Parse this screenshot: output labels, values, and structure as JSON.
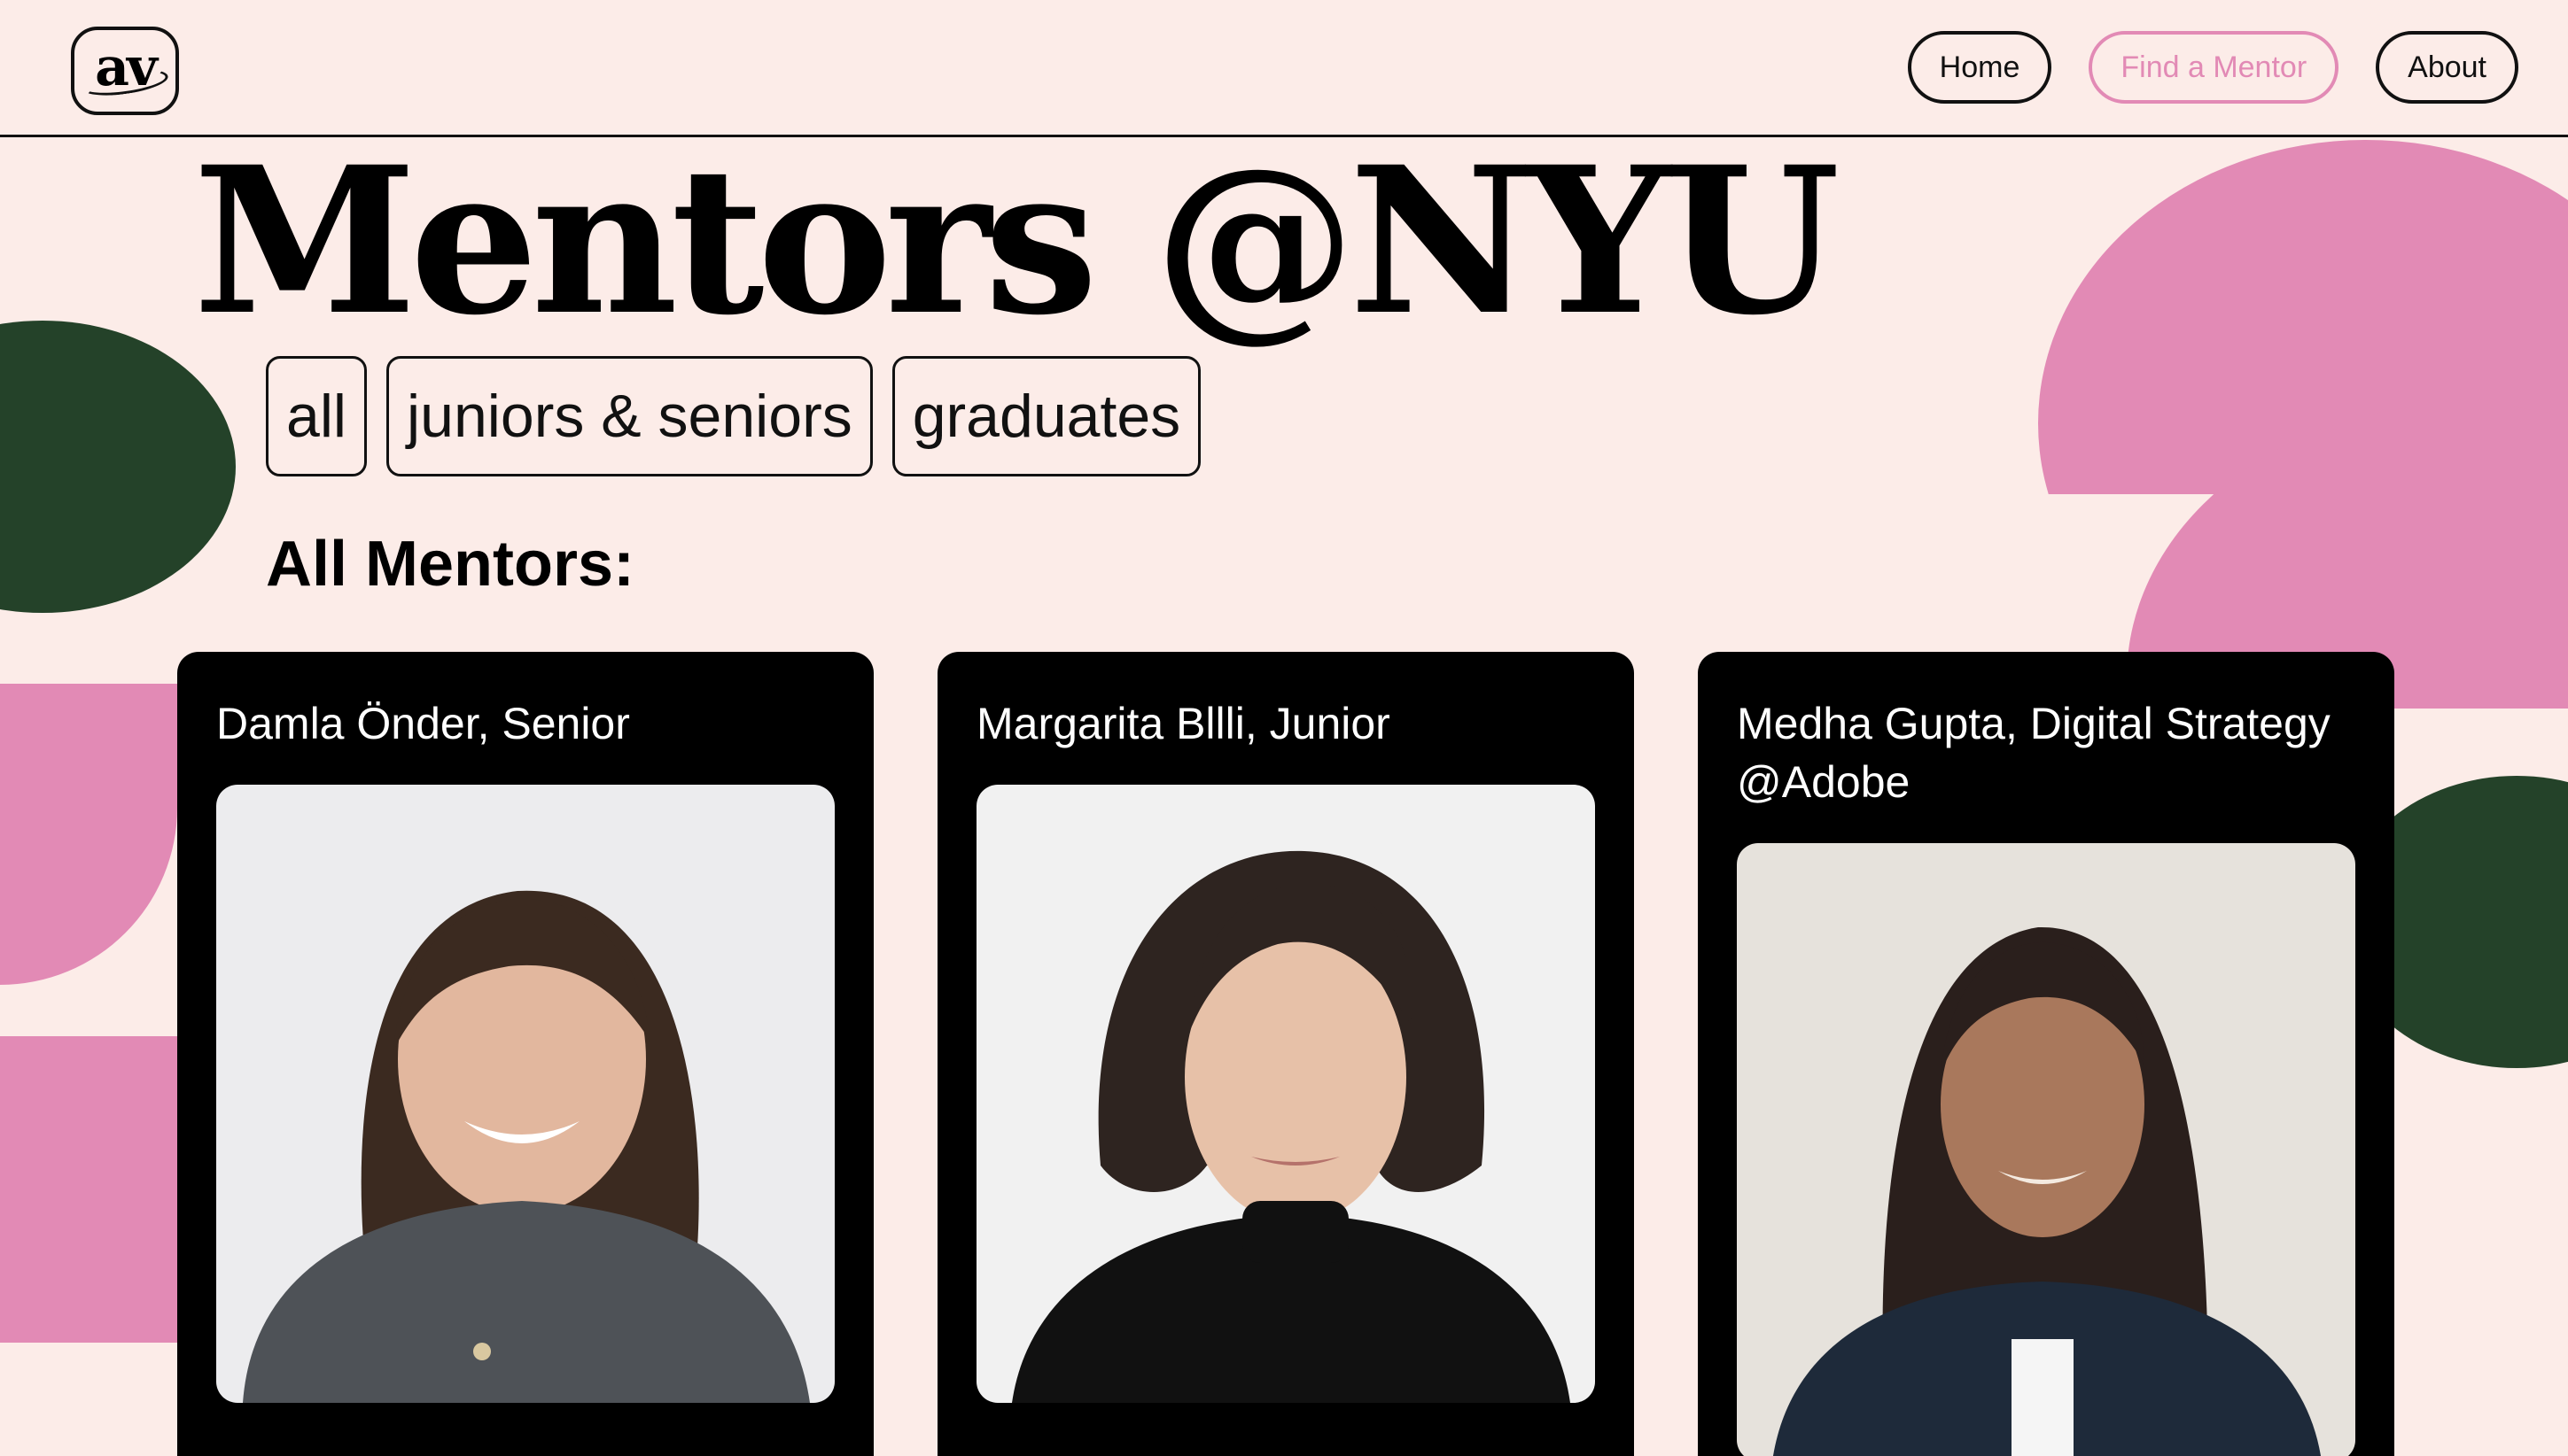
{
  "header": {
    "logo_text": "av",
    "nav": [
      {
        "label": "Home",
        "active": false
      },
      {
        "label": "Find a Mentor",
        "active": true
      },
      {
        "label": "About",
        "active": false
      }
    ]
  },
  "page": {
    "title": "Mentors @NYU",
    "filters": [
      "all",
      "juniors & seniors",
      "graduates"
    ],
    "section_heading": "All Mentors:"
  },
  "mentors": [
    {
      "name": "Damla Önder, Senior",
      "photo": "mentor-photo"
    },
    {
      "name": "Margarita Bllli, Junior",
      "photo": "mentor-photo"
    },
    {
      "name": "Medha Gupta, Digital Strategy @Adobe",
      "photo": "mentor-photo"
    }
  ],
  "colors": {
    "background": "#FCECE8",
    "accent_pink": "#E28AB5",
    "accent_green": "#244229",
    "card": "#000000"
  }
}
